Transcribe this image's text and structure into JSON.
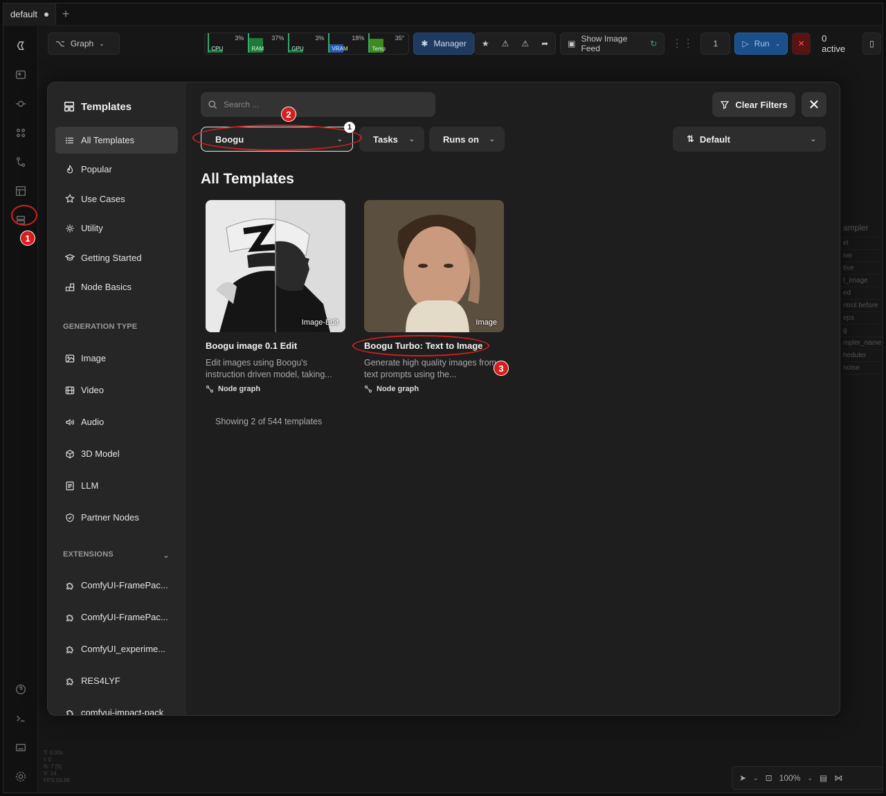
{
  "tab": {
    "name": "default"
  },
  "toolbar": {
    "graph_label": "Graph",
    "monitors": [
      {
        "label": "CPU",
        "pct": "3%",
        "fill": 0.03,
        "color": "#1f7a3a"
      },
      {
        "label": "RAM",
        "pct": "37%",
        "fill": 0.37,
        "color": "#1f7a3a"
      },
      {
        "label": "GPU",
        "pct": "3%",
        "fill": 0.03,
        "color": "#1f7a3a"
      },
      {
        "label": "VRAM",
        "pct": "18%",
        "fill": 0.18,
        "color": "#2a56b5"
      },
      {
        "label": "Temp",
        "pct": "35°",
        "fill": 0.35,
        "color": "#3d8a1f"
      }
    ],
    "manager_label": "Manager",
    "image_feed_label": "Show Image Feed",
    "queue_count": "1",
    "run_label": "Run",
    "active_label": "0 active"
  },
  "right_node": {
    "labels": [
      "ampler",
      "el",
      "ive",
      "tive",
      "t_image",
      "ed",
      "ntrol before",
      "eps",
      "g",
      "mpler_name",
      "heduler",
      "noise"
    ]
  },
  "stats": [
    "T: 0.00s",
    "I: 0",
    "N: 7 [5]",
    "V: 14",
    "FPS:59.88"
  ],
  "bottom_bar": {
    "zoom": "100%"
  },
  "modal": {
    "title": "Templates",
    "nav": [
      {
        "label": "All Templates",
        "icon": "list-icon",
        "selected": true
      },
      {
        "label": "Popular",
        "icon": "flame-icon"
      },
      {
        "label": "Use Cases",
        "icon": "star-icon"
      },
      {
        "label": "Utility",
        "icon": "gear-icon"
      },
      {
        "label": "Getting Started",
        "icon": "graduation-cap-icon"
      },
      {
        "label": "Node Basics",
        "icon": "blocks-icon"
      }
    ],
    "generation_section": "GENERATION TYPE",
    "generation": [
      {
        "label": "Image",
        "icon": "image-icon"
      },
      {
        "label": "Video",
        "icon": "film-icon"
      },
      {
        "label": "Audio",
        "icon": "speaker-icon"
      },
      {
        "label": "3D Model",
        "icon": "cube-icon"
      },
      {
        "label": "LLM",
        "icon": "document-icon"
      },
      {
        "label": "Partner Nodes",
        "icon": "shield-icon"
      }
    ],
    "extensions_section": "EXTENSIONS",
    "extensions": [
      {
        "label": "ComfyUI-FramePac..."
      },
      {
        "label": "ComfyUI-FramePac..."
      },
      {
        "label": "ComfyUI_experime..."
      },
      {
        "label": "RES4LYF"
      },
      {
        "label": "comfyui-impact-pack"
      }
    ],
    "search_placeholder": "Search ...",
    "clear_filters": "Clear Filters",
    "filters": {
      "model": "Boogu",
      "tasks": "Tasks",
      "runs_on": "Runs on"
    },
    "sort": "Default",
    "heading": "All Templates",
    "cards": [
      {
        "title": "Boogu image 0.1 Edit",
        "badge": "Image-Edit",
        "desc": "Edit images using Boogu's instruction driven model, taking...",
        "tag": "Node graph"
      },
      {
        "title": "Boogu Turbo: Text to Image",
        "badge": "Image",
        "desc": "Generate high quality images from text prompts using the...",
        "tag": "Node graph"
      }
    ],
    "showing": "Showing 2 of 544 templates"
  },
  "annotations": [
    "1",
    "2",
    "1",
    "3"
  ]
}
